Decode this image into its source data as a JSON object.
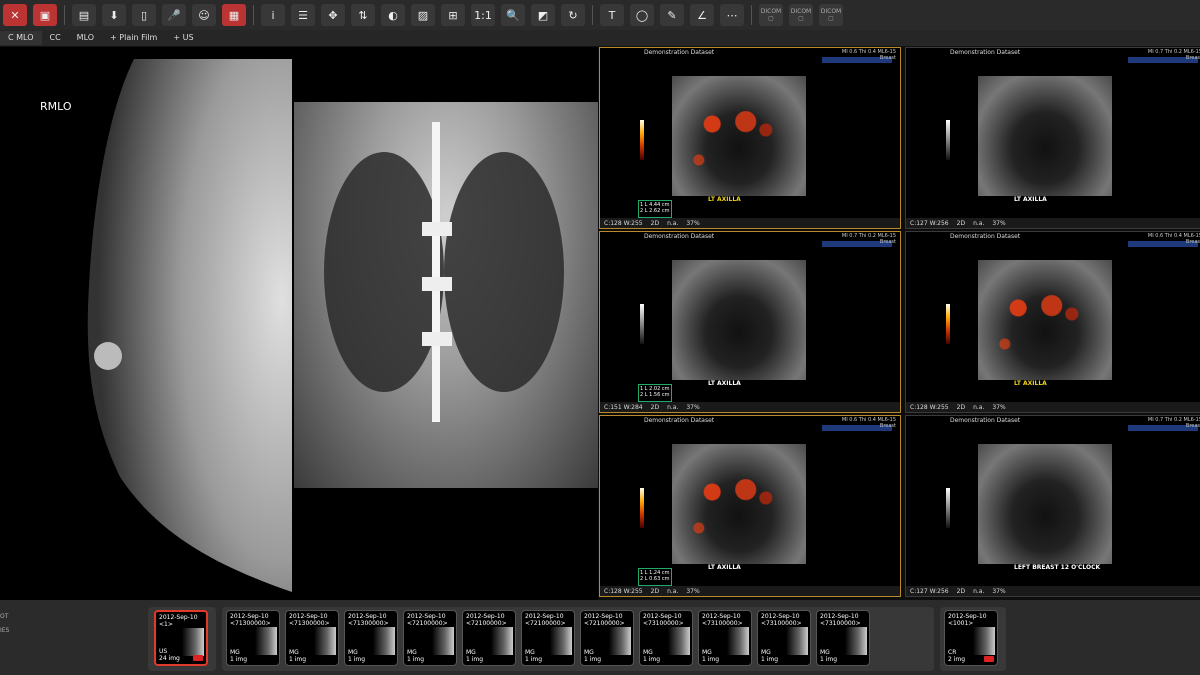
{
  "tabs": [
    "C MLO",
    "CC",
    "MLO",
    "+ Plain Film",
    "+ US"
  ],
  "toolbar": {
    "info": "i",
    "one_to_one": "1:1",
    "dicom": "DICOM"
  },
  "mammo": {
    "label": "RMLO"
  },
  "viewports": [
    {
      "title": "Demonstration Dataset",
      "info": "MI 0.6 Thi 0.4 ML6-15",
      "organ": "Breast",
      "label": "LT AXILLA",
      "label_color": "y",
      "doppler": true,
      "meas": [
        "1 L 4.44 cm",
        "2 L 2.62 cm"
      ],
      "status": [
        "C:128 W:255",
        "2D",
        "n.a.",
        "37%"
      ]
    },
    {
      "title": "Demonstration Dataset",
      "info": "MI 0.7 Thi 0.2 ML6-15",
      "organ": "Breast",
      "label": "LT AXILLA",
      "label_color": "w",
      "doppler": false,
      "meas": [],
      "status": [
        "C:127 W:256",
        "2D",
        "n.a.",
        "37%"
      ]
    },
    {
      "title": "Demonstration Dataset",
      "info": "MI 0.7 Thi 0.2 ML6-15",
      "organ": "Breast",
      "label": "LT AXILLA",
      "label_color": "w",
      "doppler": false,
      "meas": [
        "1 L 2.02 cm",
        "2 L 1.56 cm"
      ],
      "status": [
        "C:151 W:284",
        "2D",
        "n.a.",
        "37%"
      ]
    },
    {
      "title": "Demonstration Dataset",
      "info": "MI 0.6 Thi 0.4 ML6-15",
      "organ": "Breast",
      "label": "LT AXILLA",
      "label_color": "y",
      "doppler": true,
      "meas": [],
      "status": [
        "C:128 W:255",
        "2D",
        "n.a.",
        "37%"
      ]
    },
    {
      "title": "Demonstration Dataset",
      "info": "MI 0.6 Thi 0.4 ML6-15",
      "organ": "Breast",
      "label": "LT AXILLA",
      "label_color": "w",
      "doppler": true,
      "meas": [
        "1 L 1.24 cm",
        "2 L 0.63 cm"
      ],
      "status": [
        "C:128 W:255",
        "2D",
        "n.a.",
        "37%"
      ]
    },
    {
      "title": "Demonstration Dataset",
      "info": "MI 0.7 Thi 0.2 ML6-15",
      "organ": "Breast",
      "label": "LEFT BREAST 12 O'CLOCK",
      "label_color": "w",
      "doppler": false,
      "meas": [],
      "status": [
        "C:127 W:256",
        "2D",
        "n.a.",
        "37%"
      ]
    }
  ],
  "thumbs": [
    {
      "date": "2012-Sep-10",
      "id": "<1>",
      "mod": "US",
      "count": "24 img",
      "selected": true
    },
    {
      "date": "2012-Sep-10",
      "id": "<71300000>",
      "mod": "MG",
      "count": "1 img"
    },
    {
      "date": "2012-Sep-10",
      "id": "<71300000>",
      "mod": "MG",
      "count": "1 img"
    },
    {
      "date": "2012-Sep-10",
      "id": "<71300000>",
      "mod": "MG",
      "count": "1 img"
    },
    {
      "date": "2012-Sep-10",
      "id": "<72100000>",
      "mod": "MG",
      "count": "1 img"
    },
    {
      "date": "2012-Sep-10",
      "id": "<72100000>",
      "mod": "MG",
      "count": "1 img"
    },
    {
      "date": "2012-Sep-10",
      "id": "<72100000>",
      "mod": "MG",
      "count": "1 img"
    },
    {
      "date": "2012-Sep-10",
      "id": "<72100000>",
      "mod": "MG",
      "count": "1 img"
    },
    {
      "date": "2012-Sep-10",
      "id": "<73100000>",
      "mod": "MG",
      "count": "1 img"
    },
    {
      "date": "2012-Sep-10",
      "id": "<73100000>",
      "mod": "MG",
      "count": "1 img"
    },
    {
      "date": "2012-Sep-10",
      "id": "<73100000>",
      "mod": "MG",
      "count": "1 img"
    },
    {
      "date": "2012-Sep-10",
      "id": "<73100000>",
      "mod": "MG",
      "count": "1 img"
    },
    {
      "date": "2012-Sep-10",
      "id": "<1001>",
      "mod": "CR",
      "count": "2 img"
    }
  ],
  "side": {
    "a": "OT",
    "b": "IES"
  }
}
